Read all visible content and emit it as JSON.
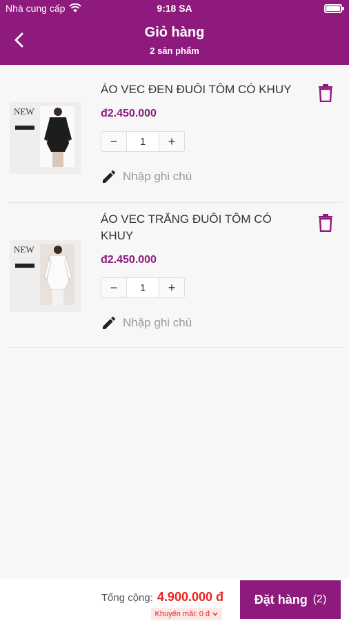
{
  "status": {
    "carrier": "Nhà cung cấp",
    "time": "9:18 SA"
  },
  "header": {
    "title": "Giỏ hàng",
    "subtitle": "2 sản phẩm"
  },
  "items": [
    {
      "name": "ÁO VEC ĐEN ĐUÔI TÔM CÓ KHUY",
      "price": "đ2.450.000",
      "qty": "1",
      "note_placeholder": "Nhập ghi chú",
      "image": "black-jacket-image"
    },
    {
      "name": "ÁO VEC TRẮNG ĐUÔI TÔM CÓ KHUY",
      "price": "đ2.450.000",
      "qty": "1",
      "note_placeholder": "Nhập ghi chú",
      "image": "white-jacket-image"
    }
  ],
  "stepper": {
    "minus": "−",
    "plus": "+"
  },
  "footer": {
    "total_label": "Tổng cộng:",
    "total_value": "4.900.000 đ",
    "promo": "Khuyến mãi: 0 đ",
    "order_label": "Đặt hàng",
    "order_count": "(2)"
  },
  "colors": {
    "primary": "#8e1a7d",
    "accent_red": "#e8231f"
  }
}
